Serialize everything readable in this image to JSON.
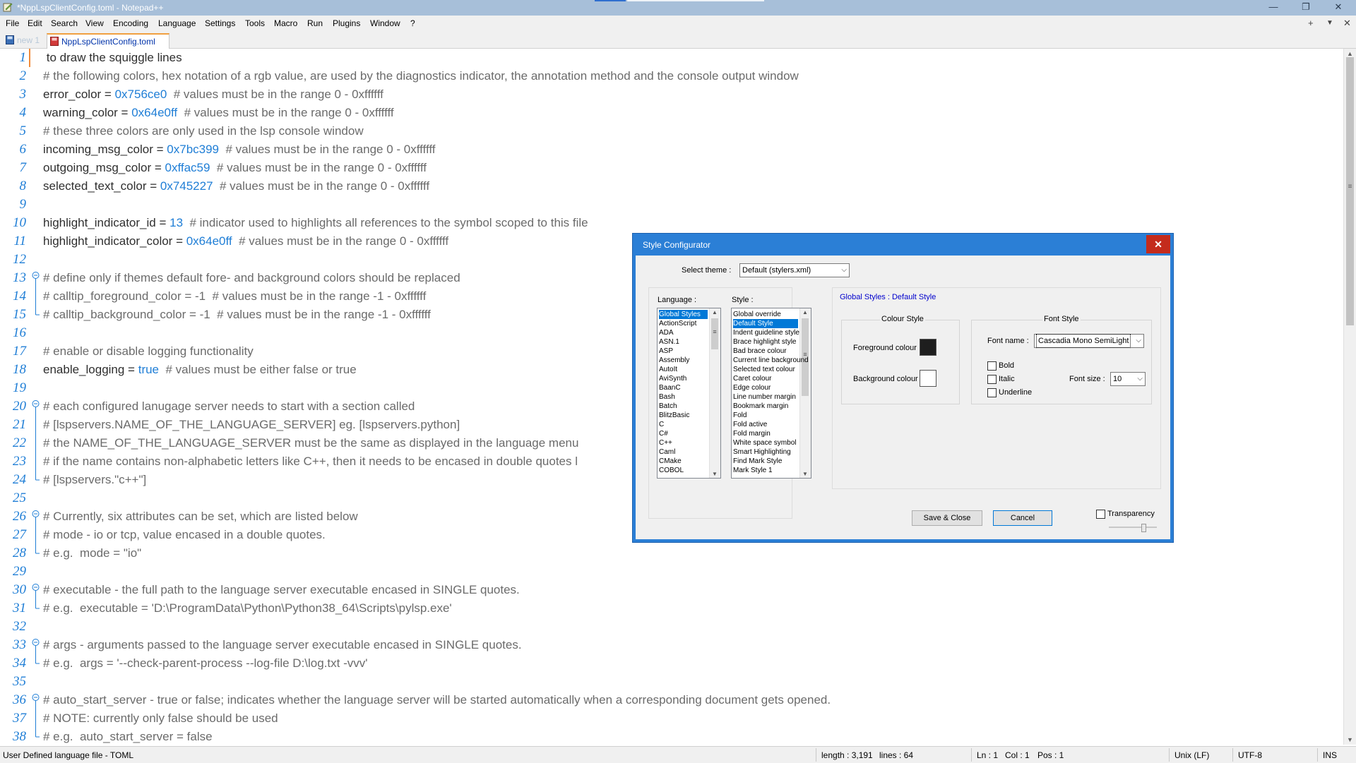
{
  "window": {
    "title": "*NppLspClientConfig.toml - Notepad++",
    "buttons": {
      "minimize": "—",
      "restore": "❐",
      "close": "✕"
    }
  },
  "menu": {
    "items": [
      "File",
      "Edit",
      "Search",
      "View",
      "Encoding",
      "Language",
      "Settings",
      "Tools",
      "Macro",
      "Run",
      "Plugins",
      "Window",
      "?"
    ],
    "right_buttons": {
      "add": "+",
      "list": "▼",
      "close": "✕"
    }
  },
  "tabs": [
    {
      "label": "new 1",
      "active": false
    },
    {
      "label": "NppLspClientConfig.toml",
      "active": true
    }
  ],
  "editor": {
    "lines": [
      {
        "n": "1",
        "fold": "",
        "parts": [
          {
            "t": " to draw the squiggle lines",
            "c": ""
          }
        ]
      },
      {
        "n": "2",
        "fold": "",
        "parts": [
          {
            "t": "# the following colors, hex notation of a rgb value, are used by the diagnostics indicator, the annotation method and the console output window",
            "c": "cmt"
          }
        ]
      },
      {
        "n": "3",
        "fold": "",
        "parts": [
          {
            "t": "error_color = ",
            "c": ""
          },
          {
            "t": "0x756ce0",
            "c": "num"
          },
          {
            "t": "  # values must be in the range 0 - 0xffffff",
            "c": "cmt"
          }
        ]
      },
      {
        "n": "4",
        "fold": "",
        "parts": [
          {
            "t": "warning_color = ",
            "c": ""
          },
          {
            "t": "0x64e0ff",
            "c": "num"
          },
          {
            "t": "  # values must be in the range 0 - 0xffffff",
            "c": "cmt"
          }
        ]
      },
      {
        "n": "5",
        "fold": "",
        "parts": [
          {
            "t": "# these three colors are only used in the lsp console window",
            "c": "cmt"
          }
        ]
      },
      {
        "n": "6",
        "fold": "",
        "parts": [
          {
            "t": "incoming_msg_color = ",
            "c": ""
          },
          {
            "t": "0x7bc399",
            "c": "num"
          },
          {
            "t": "  # values must be in the range 0 - 0xffffff",
            "c": "cmt"
          }
        ]
      },
      {
        "n": "7",
        "fold": "",
        "parts": [
          {
            "t": "outgoing_msg_color = ",
            "c": ""
          },
          {
            "t": "0xffac59",
            "c": "num"
          },
          {
            "t": "  # values must be in the range 0 - 0xffffff",
            "c": "cmt"
          }
        ]
      },
      {
        "n": "8",
        "fold": "",
        "parts": [
          {
            "t": "selected_text_color = ",
            "c": ""
          },
          {
            "t": "0x745227",
            "c": "num"
          },
          {
            "t": "  # values must be in the range 0 - 0xffffff",
            "c": "cmt"
          }
        ]
      },
      {
        "n": "9",
        "fold": "",
        "parts": []
      },
      {
        "n": "10",
        "fold": "",
        "parts": [
          {
            "t": "highlight_indicator_id = ",
            "c": ""
          },
          {
            "t": "13",
            "c": "num"
          },
          {
            "t": "  # indicator used to highlights all references to the symbol scoped to this file",
            "c": "cmt"
          }
        ]
      },
      {
        "n": "11",
        "fold": "",
        "parts": [
          {
            "t": "highlight_indicator_color = ",
            "c": ""
          },
          {
            "t": "0x64e0ff",
            "c": "num"
          },
          {
            "t": "  # values must be in the range 0 - 0xffffff",
            "c": "cmt"
          }
        ]
      },
      {
        "n": "12",
        "fold": "",
        "parts": []
      },
      {
        "n": "13",
        "fold": "start",
        "parts": [
          {
            "t": "# define only if themes default fore- and background colors should be replaced",
            "c": "cmt"
          }
        ]
      },
      {
        "n": "14",
        "fold": "mid",
        "parts": [
          {
            "t": "# calltip_foreground_color = -1  # values must be in the range -1 - 0xffffff",
            "c": "cmt"
          }
        ]
      },
      {
        "n": "15",
        "fold": "end",
        "parts": [
          {
            "t": "# calltip_background_color = -1  # values must be in the range -1 - 0xffffff",
            "c": "cmt"
          }
        ]
      },
      {
        "n": "16",
        "fold": "",
        "parts": []
      },
      {
        "n": "17",
        "fold": "",
        "parts": [
          {
            "t": "# enable or disable logging functionality",
            "c": "cmt"
          }
        ]
      },
      {
        "n": "18",
        "fold": "",
        "parts": [
          {
            "t": "enable_logging = ",
            "c": ""
          },
          {
            "t": "true",
            "c": "kw"
          },
          {
            "t": "  # values must be either false or true",
            "c": "cmt"
          }
        ]
      },
      {
        "n": "19",
        "fold": "",
        "parts": []
      },
      {
        "n": "20",
        "fold": "start",
        "parts": [
          {
            "t": "# each configured lanugage server needs to start with a section called",
            "c": "cmt"
          }
        ]
      },
      {
        "n": "21",
        "fold": "mid",
        "parts": [
          {
            "t": "# [lspservers.NAME_OF_THE_LANGUAGE_SERVER] eg. [lspservers.python]",
            "c": "cmt"
          }
        ]
      },
      {
        "n": "22",
        "fold": "mid",
        "parts": [
          {
            "t": "# the NAME_OF_THE_LANGUAGE_SERVER must be the same as displayed in the language menu",
            "c": "cmt"
          }
        ]
      },
      {
        "n": "23",
        "fold": "mid",
        "parts": [
          {
            "t": "# if the name contains non-alphabetic letters like C++, then it needs to be encased in double quotes l",
            "c": "cmt"
          }
        ]
      },
      {
        "n": "24",
        "fold": "end",
        "parts": [
          {
            "t": "# [lspservers.\"c++\"]",
            "c": "cmt"
          }
        ]
      },
      {
        "n": "25",
        "fold": "",
        "parts": []
      },
      {
        "n": "26",
        "fold": "start",
        "parts": [
          {
            "t": "# Currently, six attributes can be set, which are listed below",
            "c": "cmt"
          }
        ]
      },
      {
        "n": "27",
        "fold": "mid",
        "parts": [
          {
            "t": "# mode - io or tcp, value encased in a double quotes.",
            "c": "cmt"
          }
        ]
      },
      {
        "n": "28",
        "fold": "end",
        "parts": [
          {
            "t": "# e.g.  mode = \"io\"",
            "c": "cmt"
          }
        ]
      },
      {
        "n": "29",
        "fold": "",
        "parts": []
      },
      {
        "n": "30",
        "fold": "start",
        "parts": [
          {
            "t": "# executable - the full path to the language server executable encased in SINGLE quotes.",
            "c": "cmt"
          }
        ]
      },
      {
        "n": "31",
        "fold": "end",
        "parts": [
          {
            "t": "# e.g.  executable = 'D:\\ProgramData\\Python\\Python38_64\\Scripts\\pylsp.exe'",
            "c": "cmt"
          }
        ]
      },
      {
        "n": "32",
        "fold": "",
        "parts": []
      },
      {
        "n": "33",
        "fold": "start",
        "parts": [
          {
            "t": "# args - arguments passed to the language server executable encased in SINGLE quotes.",
            "c": "cmt"
          }
        ]
      },
      {
        "n": "34",
        "fold": "end",
        "parts": [
          {
            "t": "# e.g.  args = '--check-parent-process --log-file D:\\log.txt -vvv'",
            "c": "cmt"
          }
        ]
      },
      {
        "n": "35",
        "fold": "",
        "parts": []
      },
      {
        "n": "36",
        "fold": "start",
        "parts": [
          {
            "t": "# auto_start_server - true or false; indicates whether the language server will be started automatically when a corresponding document gets opened.",
            "c": "cmt"
          }
        ]
      },
      {
        "n": "37",
        "fold": "mid",
        "parts": [
          {
            "t": "# NOTE: currently only false should be used",
            "c": "cmt"
          }
        ]
      },
      {
        "n": "38",
        "fold": "end",
        "parts": [
          {
            "t": "# e.g.  auto_start_server = false",
            "c": "cmt"
          }
        ]
      }
    ]
  },
  "status": {
    "file_type": "User Defined language file - TOML",
    "length": "length : 3,191",
    "lines": "lines : 64",
    "ln": "Ln : 1",
    "col": "Col : 1",
    "pos": "Pos : 1",
    "eol": "Unix (LF)",
    "encoding": "UTF-8",
    "mode": "INS"
  },
  "dialog": {
    "title": "Style Configurator",
    "close": "✕",
    "select_theme_label": "Select theme :",
    "theme_value": "Default (stylers.xml)",
    "language_label": "Language :",
    "style_label": "Style :",
    "languages": [
      "Global Styles",
      "ActionScript",
      "ADA",
      "ASN.1",
      "ASP",
      "Assembly",
      "AutoIt",
      "AviSynth",
      "BaanC",
      "Bash",
      "Batch",
      "BlitzBasic",
      "C",
      "C#",
      "C++",
      "Caml",
      "CMake",
      "COBOL"
    ],
    "styles": [
      "Global override",
      "Default Style",
      "Indent guideline style",
      "Brace highlight style",
      "Bad brace colour",
      "Current line background",
      "Selected text colour",
      "Caret colour",
      "Edge colour",
      "Line number margin",
      "Bookmark margin",
      "Fold",
      "Fold active",
      "Fold margin",
      "White space symbol",
      "Smart Highlighting",
      "Find Mark Style",
      "Mark Style 1"
    ],
    "selected_header": "Global Styles : Default Style",
    "colour_style_label": "Colour Style",
    "foreground_label": "Foreground colour",
    "background_label": "Background colour",
    "font_style_label": "Font Style",
    "font_name_label": "Font name :",
    "font_name_value": "Cascadia Mono SemiLight",
    "bold_label": "Bold",
    "italic_label": "Italic",
    "underline_label": "Underline",
    "font_size_label": "Font size :",
    "font_size_value": "10",
    "save_close_label": "Save & Close",
    "cancel_label": "Cancel",
    "transparency_label": "Transparency",
    "colors": {
      "foreground": "#1e1e1e",
      "background": "#ffffff"
    }
  }
}
